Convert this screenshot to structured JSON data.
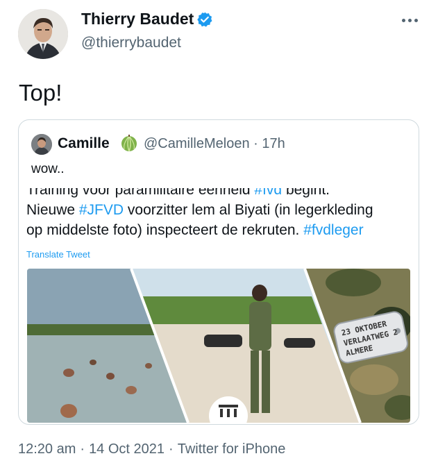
{
  "author": {
    "name": "Thierry Baudet",
    "handle": "@thierrybaudet"
  },
  "tweet": {
    "text": "Top!"
  },
  "quoted": {
    "name": "Camille",
    "handle_time": "@CamilleMeloen · 17h",
    "text": "wow..",
    "body_line1": "Training voor paramilitaire eenheid ",
    "body_line1_tag": "#fvd",
    "body_line1_end": " begint.",
    "body_line2_pre": "Nieuwe ",
    "body_line2_tag": "#JFVD",
    "body_line2_post": " voorzitter lem al Biyati (in legerkleding",
    "body_line3_pre": "op middelste foto) inspecteert de rekruten. ",
    "body_line3_tag": "#fvdleger",
    "translate": "Translate Tweet",
    "media": {
      "tag_line1": "23 OKTOBER",
      "tag_line2": "VERLAATWEG 2",
      "tag_line3": "ALMERE"
    }
  },
  "footer": {
    "time": "12:20 am",
    "date": "14 Oct 2021",
    "source": "Twitter for iPhone"
  },
  "colors": {
    "accent": "#1d9bf0",
    "muted": "#536471"
  }
}
